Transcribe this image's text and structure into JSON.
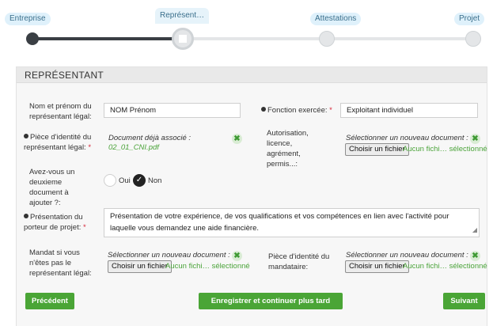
{
  "stepper": {
    "steps": [
      {
        "label": "Entreprise",
        "state": "done"
      },
      {
        "label": "Représent…",
        "state": "current"
      },
      {
        "label": "Attestations",
        "state": "todo"
      },
      {
        "label": "Projet",
        "state": "todo"
      }
    ]
  },
  "section": {
    "title": "REPRÉSENTANT"
  },
  "form": {
    "nom_label": "Nom et prénom du représentant légal:",
    "nom_value": "NOM Prénom",
    "fonction_label": "Fonction exercée:",
    "fonction_req": "*",
    "fonction_value": "Exploitant individuel",
    "piece_label": "Pièce d'identité du représentant légal:",
    "piece_req": "*",
    "piece_status": "Document déjà associé :",
    "piece_file": "02_01_CNI.pdf",
    "autorisation_label": "Autorisation, licence, agrément, permis...:",
    "autorisation_prompt": "Sélectionner un nouveau document :",
    "deuxieme_label": "Avez-vous un deuxieme document à ajouter ?:",
    "radio_oui": "Oui",
    "radio_non": "Non",
    "presentation_label": "Présentation du porteur de projet:",
    "presentation_req": "*",
    "presentation_value": "Présentation de votre expérience, de vos qualifications et vos compétences en lien avec l'activité pour laquelle vous demandez une aide financière.",
    "mandat_label": "Mandat si vous n'êtes pas le représentant légal:",
    "mandat_prompt": "Sélectionner un nouveau document :",
    "mandataire_label": "Pièce d'identité du mandataire:",
    "mandataire_prompt": "Sélectionner un nouveau document :",
    "file_button": "Choisir un fichier",
    "file_none": "Aucun fichi… sélectionné",
    "remove_symbol": "✖"
  },
  "actions": {
    "previous": "Précédent",
    "save": "Enregistrer et continuer plus tard",
    "next": "Suivant"
  },
  "colors": {
    "accent": "#4aa536",
    "required": "#d6283a",
    "step_tab": "#dff1fb"
  }
}
